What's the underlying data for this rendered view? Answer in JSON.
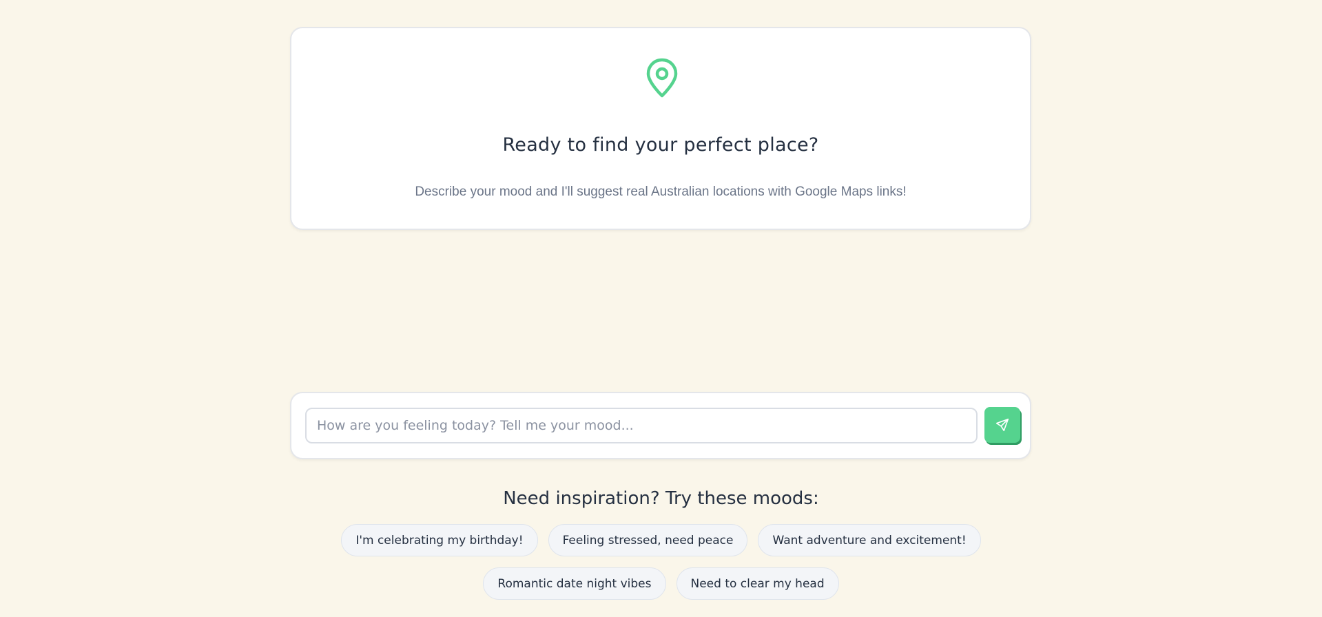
{
  "welcome": {
    "icon": "map-pin-icon",
    "title": "Ready to find your perfect place?",
    "subtitle": "Describe your mood and I'll suggest real Australian locations with Google Maps links!"
  },
  "composer": {
    "placeholder": "How are you feeling today? Tell me your mood...",
    "value": "",
    "send_icon": "send-icon"
  },
  "inspiration": {
    "heading": "Need inspiration? Try these moods:",
    "row1": [
      "I'm celebrating my birthday!",
      "Feeling stressed, need peace",
      "Want adventure and excitement!"
    ],
    "row2": [
      "Romantic date night vibes",
      "Need to clear my head"
    ]
  },
  "colors": {
    "background": "#faf6ea",
    "accent": "#55d38e",
    "text": "#253041",
    "muted_text": "#6b7588"
  }
}
